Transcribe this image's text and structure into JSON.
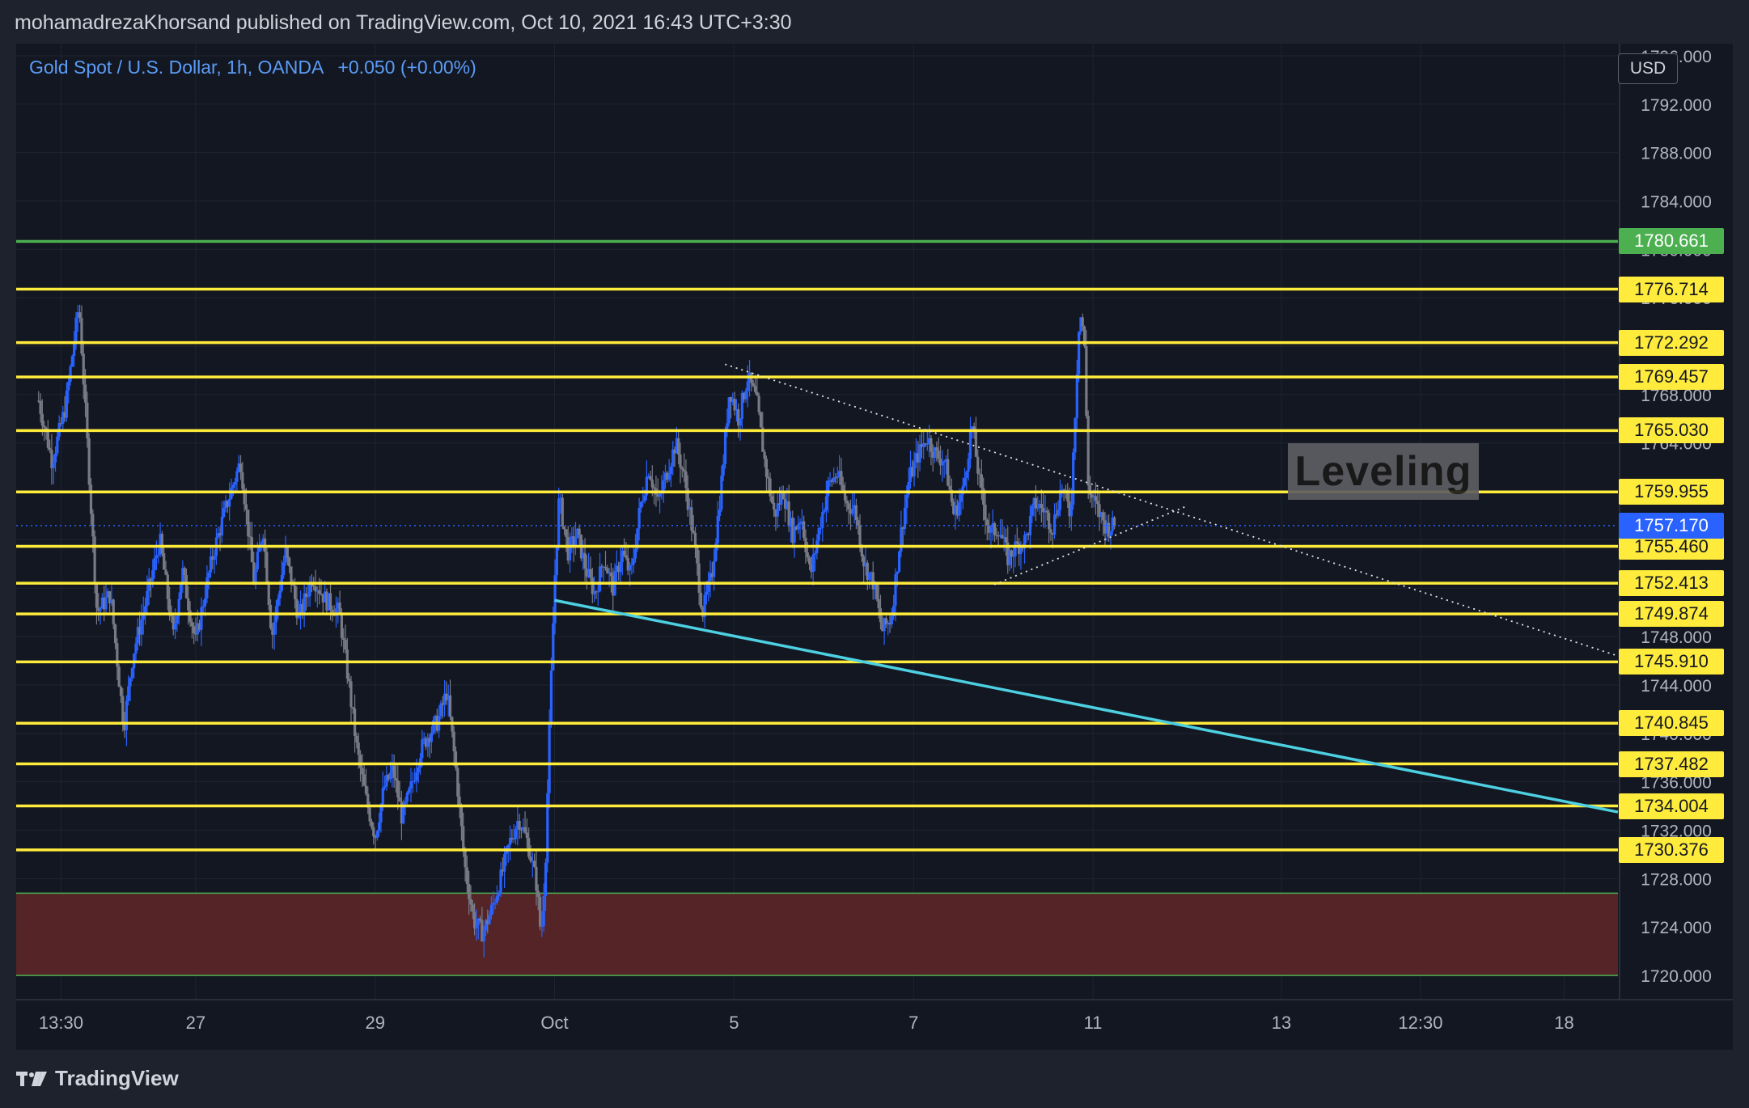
{
  "header": {
    "published_text": "mohamadrezaKhorsand published on TradingView.com, Oct 10, 2021 16:43 UTC+3:30"
  },
  "symbol": {
    "name": "Gold Spot / U.S. Dollar, 1h, OANDA",
    "change": "+0.050 (+0.00%)"
  },
  "currency_badge": "USD",
  "annotation": "Leveling",
  "footer": {
    "logo_icon": "tradingview-logo-icon",
    "brand": "TradingView"
  },
  "colors": {
    "background": "#131722",
    "panel": "#1e222d",
    "bullish": "#2962ff",
    "bearish": "#787b86",
    "yellow_level": "#ffeb3b",
    "green_level": "#4caf50",
    "trend_line": "#4dd0e1",
    "zone": "#5c2628",
    "current_price": "#2962ff"
  },
  "chart_data": {
    "type": "candlestick",
    "instrument": "Gold Spot / U.S. Dollar",
    "timeframe": "1h",
    "ylim": [
      1718,
      1797
    ],
    "y_ticks": [
      1720,
      1724,
      1728,
      1732,
      1736,
      1740,
      1744,
      1748,
      1752,
      1756,
      1760,
      1764,
      1768,
      1772,
      1776,
      1780,
      1784,
      1788,
      1792,
      1796
    ],
    "y_tick_labels": [
      "1720.000",
      "1724.000",
      "1728.000",
      "1732.000",
      "1736.000",
      "1740.000",
      "1744.000",
      "1748.000",
      "1752.000",
      "1756.000",
      "1760.000",
      "1764.000",
      "1768.000",
      "1772.000",
      "1776.000",
      "1780.000",
      "1784.000",
      "1788.000",
      "1792.000",
      "1796.000"
    ],
    "x_tick_labels": [
      {
        "label": "13:30",
        "t": 0.5
      },
      {
        "label": "27",
        "t": 3.5
      },
      {
        "label": "29",
        "t": 7.5
      },
      {
        "label": "Oct",
        "t": 11.5
      },
      {
        "label": "5",
        "t": 15.5
      },
      {
        "label": "7",
        "t": 19.5
      },
      {
        "label": "11",
        "t": 23.5
      },
      {
        "label": "13",
        "t": 27.7
      },
      {
        "label": "12:30",
        "t": 30.8
      },
      {
        "label": "18",
        "t": 34.0
      }
    ],
    "xlim": [
      -0.5,
      35.2
    ],
    "last_candle_t": 24.0,
    "levels": [
      {
        "value": 1780.661,
        "label": "1780.661",
        "color": "green"
      },
      {
        "value": 1776.714,
        "label": "1776.714",
        "color": "yellow"
      },
      {
        "value": 1772.292,
        "label": "1772.292",
        "color": "yellow"
      },
      {
        "value": 1769.457,
        "label": "1769.457",
        "color": "yellow"
      },
      {
        "value": 1765.03,
        "label": "1765.030",
        "color": "yellow"
      },
      {
        "value": 1759.955,
        "label": "1759.955",
        "color": "yellow"
      },
      {
        "value": 1755.46,
        "label": "1755.460",
        "color": "yellow"
      },
      {
        "value": 1752.413,
        "label": "1752.413",
        "color": "yellow"
      },
      {
        "value": 1749.874,
        "label": "1749.874",
        "color": "yellow"
      },
      {
        "value": 1745.91,
        "label": "1745.910",
        "color": "yellow"
      },
      {
        "value": 1740.845,
        "label": "1740.845",
        "color": "yellow"
      },
      {
        "value": 1737.482,
        "label": "1737.482",
        "color": "yellow"
      },
      {
        "value": 1734.004,
        "label": "1734.004",
        "color": "yellow"
      },
      {
        "value": 1730.376,
        "label": "1730.376",
        "color": "yellow"
      }
    ],
    "current_price": {
      "value": 1757.17,
      "label": "1757.170"
    },
    "zone": {
      "low": 1720.0,
      "high": 1726.8
    },
    "trend_line": {
      "t1": 11.5,
      "v1": 1751.0,
      "t2": 35.2,
      "v2": 1733.5
    },
    "dotted_lines": [
      {
        "t1": 15.3,
        "v1": 1770.5,
        "t2": 35.2,
        "v2": 1746.4
      },
      {
        "t1": 21.3,
        "v1": 1752.3,
        "t2": 25.6,
        "v2": 1758.8
      }
    ],
    "price_path": [
      [
        0.0,
        1767.5
      ],
      [
        0.3,
        1762.5
      ],
      [
        0.6,
        1767.0
      ],
      [
        0.9,
        1775.5
      ],
      [
        1.1,
        1763.0
      ],
      [
        1.3,
        1750.0
      ],
      [
        1.6,
        1751.5
      ],
      [
        1.9,
        1740.5
      ],
      [
        2.1,
        1746.5
      ],
      [
        2.4,
        1751.0
      ],
      [
        2.7,
        1756.0
      ],
      [
        3.0,
        1748.0
      ],
      [
        3.2,
        1753.5
      ],
      [
        3.5,
        1747.5
      ],
      [
        3.7,
        1751.5
      ],
      [
        3.9,
        1755.0
      ],
      [
        4.2,
        1759.0
      ],
      [
        4.5,
        1762.5
      ],
      [
        4.8,
        1752.5
      ],
      [
        5.0,
        1757.0
      ],
      [
        5.2,
        1748.0
      ],
      [
        5.5,
        1755.0
      ],
      [
        5.8,
        1749.5
      ],
      [
        6.1,
        1753.0
      ],
      [
        6.4,
        1751.0
      ],
      [
        6.7,
        1750.0
      ],
      [
        6.9,
        1744.5
      ],
      [
        7.1,
        1738.5
      ],
      [
        7.3,
        1734.5
      ],
      [
        7.5,
        1731.5
      ],
      [
        7.7,
        1735.5
      ],
      [
        7.9,
        1737.0
      ],
      [
        8.1,
        1733.0
      ],
      [
        8.3,
        1735.5
      ],
      [
        8.5,
        1738.5
      ],
      [
        8.7,
        1740.0
      ],
      [
        8.9,
        1741.0
      ],
      [
        9.1,
        1743.5
      ],
      [
        9.3,
        1737.0
      ],
      [
        9.5,
        1729.0
      ],
      [
        9.7,
        1724.5
      ],
      [
        9.9,
        1723.5
      ],
      [
        10.1,
        1725.5
      ],
      [
        10.3,
        1728.0
      ],
      [
        10.5,
        1731.0
      ],
      [
        10.7,
        1733.0
      ],
      [
        10.9,
        1731.0
      ],
      [
        11.1,
        1727.5
      ],
      [
        11.2,
        1723.0
      ],
      [
        11.3,
        1730.0
      ],
      [
        11.4,
        1742.0
      ],
      [
        11.5,
        1752.5
      ],
      [
        11.6,
        1759.5
      ],
      [
        11.8,
        1755.0
      ],
      [
        12.0,
        1756.5
      ],
      [
        12.2,
        1753.5
      ],
      [
        12.4,
        1751.5
      ],
      [
        12.6,
        1754.5
      ],
      [
        12.8,
        1752.0
      ],
      [
        13.0,
        1755.0
      ],
      [
        13.2,
        1753.0
      ],
      [
        13.4,
        1758.5
      ],
      [
        13.6,
        1762.0
      ],
      [
        13.8,
        1759.0
      ],
      [
        14.0,
        1761.5
      ],
      [
        14.2,
        1764.0
      ],
      [
        14.4,
        1761.0
      ],
      [
        14.6,
        1756.0
      ],
      [
        14.8,
        1750.0
      ],
      [
        15.0,
        1753.0
      ],
      [
        15.2,
        1760.0
      ],
      [
        15.4,
        1768.5
      ],
      [
        15.6,
        1766.0
      ],
      [
        15.8,
        1769.5
      ],
      [
        16.0,
        1767.5
      ],
      [
        16.2,
        1762.0
      ],
      [
        16.4,
        1758.0
      ],
      [
        16.6,
        1760.0
      ],
      [
        16.8,
        1756.5
      ],
      [
        17.0,
        1758.0
      ],
      [
        17.2,
        1753.0
      ],
      [
        17.4,
        1757.0
      ],
      [
        17.6,
        1760.5
      ],
      [
        17.8,
        1761.5
      ],
      [
        18.0,
        1759.0
      ],
      [
        18.2,
        1758.5
      ],
      [
        18.4,
        1754.0
      ],
      [
        18.6,
        1752.5
      ],
      [
        18.8,
        1748.5
      ],
      [
        19.0,
        1749.5
      ],
      [
        19.2,
        1756.0
      ],
      [
        19.4,
        1761.0
      ],
      [
        19.6,
        1763.0
      ],
      [
        19.8,
        1764.5
      ],
      [
        20.0,
        1763.0
      ],
      [
        20.2,
        1762.5
      ],
      [
        20.4,
        1758.0
      ],
      [
        20.6,
        1760.0
      ],
      [
        20.8,
        1765.5
      ],
      [
        21.0,
        1760.0
      ],
      [
        21.2,
        1756.5
      ],
      [
        21.4,
        1757.0
      ],
      [
        21.6,
        1754.5
      ],
      [
        21.8,
        1755.5
      ],
      [
        22.0,
        1756.0
      ],
      [
        22.2,
        1759.0
      ],
      [
        22.4,
        1758.5
      ],
      [
        22.6,
        1757.0
      ],
      [
        22.8,
        1760.5
      ],
      [
        23.0,
        1758.0
      ],
      [
        23.2,
        1775.0
      ],
      [
        23.3,
        1773.0
      ],
      [
        23.4,
        1760.0
      ],
      [
        23.6,
        1758.5
      ],
      [
        23.8,
        1757.0
      ],
      [
        24.0,
        1757.2
      ]
    ]
  }
}
